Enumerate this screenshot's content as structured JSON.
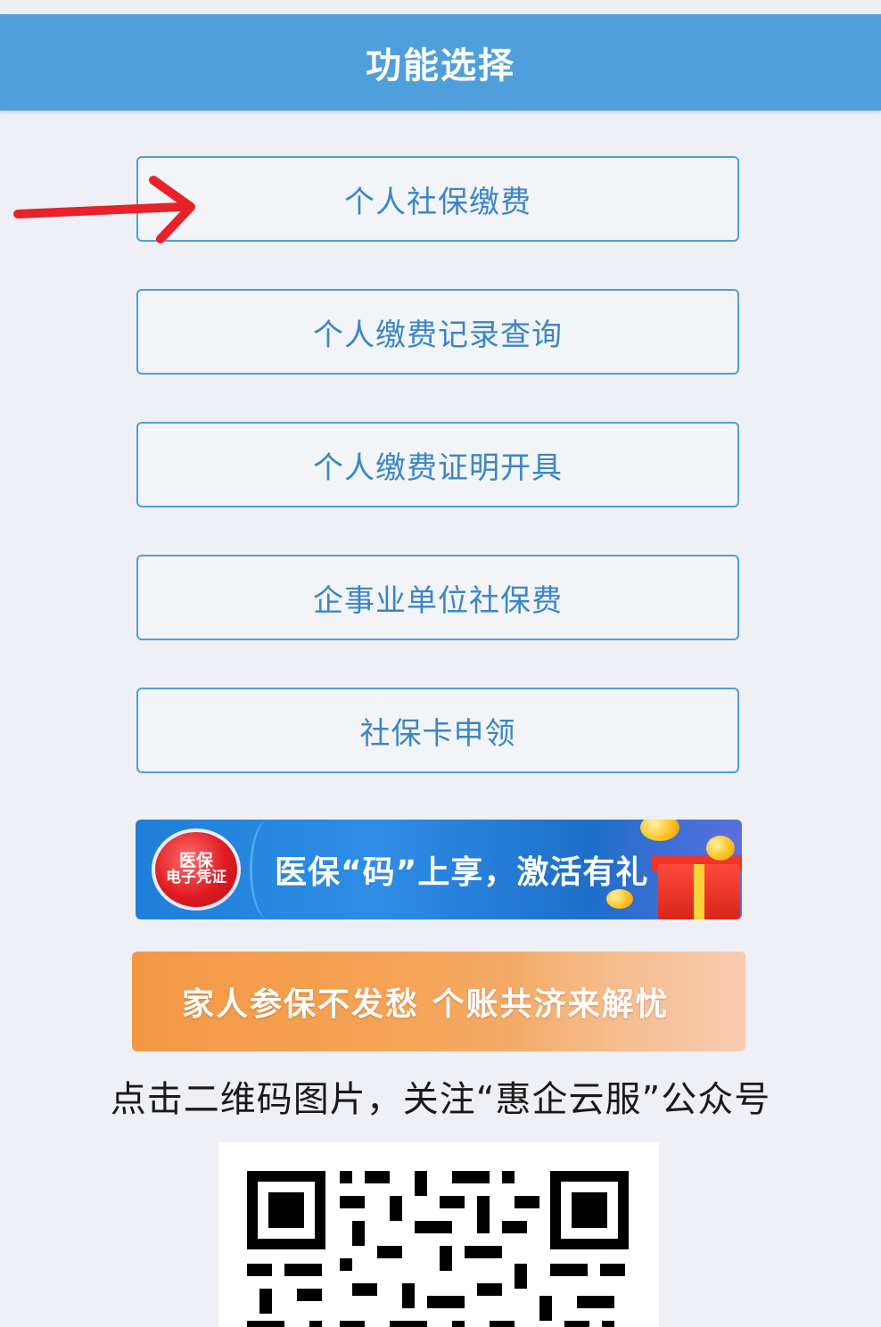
{
  "header": {
    "title": "功能选择"
  },
  "menu": {
    "items": [
      {
        "label": "个人社保缴费"
      },
      {
        "label": "个人缴费记录查询"
      },
      {
        "label": "个人缴费证明开具"
      },
      {
        "label": "企事业单位社保费"
      },
      {
        "label": "社保卡申领"
      }
    ]
  },
  "banners": {
    "medical": {
      "badge_line1": "医保",
      "badge_line2": "电子凭证",
      "text": "医保“码”上享，激活有礼"
    },
    "family": {
      "text": "家人参保不发愁  个账共济来解忧"
    }
  },
  "qr": {
    "caption": "点击二维码图片，关注“惠企云服”公众号"
  },
  "colors": {
    "accent": "#4f9fdc",
    "arrow": "#e8212a",
    "background": "#eef0f5"
  },
  "icons": {
    "arrow": "red-arrow-icon",
    "qr": "qr-code-icon"
  }
}
